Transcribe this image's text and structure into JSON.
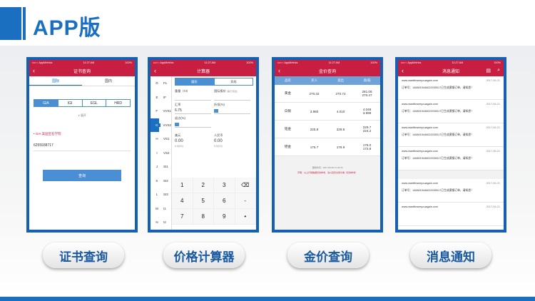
{
  "header": {
    "title": "APP版"
  },
  "status_bar": {
    "carrier": "•••○○ AppMetrics",
    "time": "11:27 AM",
    "battery": "100%"
  },
  "screen1": {
    "nav_title": "证书查询",
    "tabs": [
      "国际",
      "国内"
    ],
    "labs": [
      "GIA",
      "IGI",
      "EGL",
      "HRD"
    ],
    "more": "∨ 展开",
    "lab_line": "• GIA 美国宝石学院",
    "cert_number": "6255938717",
    "query_button": "查询"
  },
  "screen2": {
    "nav_title": "计算器",
    "side": [
      [
        "D",
        "FL"
      ],
      [
        "E",
        "IF"
      ],
      [
        "F",
        "VVS1"
      ],
      [
        "G",
        "VVS2"
      ],
      [
        "H",
        "VS1"
      ],
      [
        "I",
        "VS2"
      ],
      [
        "J",
        "SI1"
      ],
      [
        "K",
        "SI2"
      ],
      [
        "L",
        "SI3"
      ],
      [
        "M",
        "I1"
      ],
      [
        "N",
        "I2"
      ]
    ],
    "tabs": [
      "圆形",
      "异形"
    ],
    "weight_label": "重量（Ct）",
    "intl_price_label": "国际报价",
    "intl_price_unit": "(美元/克拉)",
    "rate_label": "汇率",
    "rate_value": "6.75",
    "discount_label": "折扣(%)",
    "rebate_label": "退点(%)",
    "usd_label": "美元",
    "cny_label": "人民币",
    "usd_value": "0.00",
    "cny_value": "0.00",
    "usd_ct": "0.0(/Ct)",
    "cny_ct": "0.0(/Ct)",
    "keypad": [
      [
        "1",
        "2",
        "3",
        "⌫"
      ],
      [
        "4",
        "5",
        "6",
        "-"
      ],
      [
        "7",
        "8",
        "9",
        "•"
      ]
    ]
  },
  "screen3": {
    "nav_title": "金价查询",
    "headers": [
      "品名",
      "买入",
      "卖出",
      "高/低"
    ],
    "rows": [
      {
        "name": "黄金",
        "buy": "270.32",
        "sell": "270.72",
        "high": "281.06",
        "low": "270.47"
      },
      {
        "name": "白银",
        "buy": "3.980",
        "sell": "4.010",
        "high": "4.048",
        "low": "3.999"
      },
      {
        "name": "铂金",
        "buy": "225.8",
        "sell": "228.6",
        "high": "229.7",
        "low": "224.2"
      },
      {
        "name": "钯金",
        "buy": "175.7",
        "sell": "176.9",
        "high": "178.0",
        "low": "172.8"
      }
    ],
    "update_time": "更新时间：2017-06-05  17:20:15",
    "disclaimer": "声明：以上行情数据仅供参考，请以实际交易为准（仅供参考）"
  },
  "screen4": {
    "nav_title": "消息通知",
    "messages": [
      {
        "site": "www.wantttoseeyouagain.com",
        "date": "2017-06-21",
        "text": "订单号：1468019446022030017已生成黄钢订单，请知悉！"
      },
      {
        "site": "www.wantttoseeyouagain.com",
        "date": "2017-06-21",
        "text": "订单号：1468019446022030017已生成黄钢订单，请知悉！"
      },
      {
        "site": "www.wantttoseeyouagain.com",
        "date": "2017-06-21",
        "text": "订单号：1468019446022030017已生成黄钢订单，请知悉！"
      },
      {
        "site": "www.wantttoseeyouagain.com",
        "date": "2017-06-21",
        "text": "订单号：1468019446022030017已生成黄钢订单，请知悉！"
      },
      {
        "site": "www.wantttoseeyouagain.com",
        "date": "2017-06-21",
        "text": "订单号：1468019446022030017已生成黄钢订单，请知悉！"
      },
      {
        "site": "www.wantttoseeyouagain.com",
        "date": "2017-06-21",
        "text": ""
      }
    ]
  },
  "labels": {
    "l1": "证书查询",
    "l2": "价格计算器",
    "l3": "金价查询",
    "l4": "消息通知"
  },
  "colors": {
    "brand_blue": "#1a6fc1",
    "nav_red": "#c71e42"
  }
}
